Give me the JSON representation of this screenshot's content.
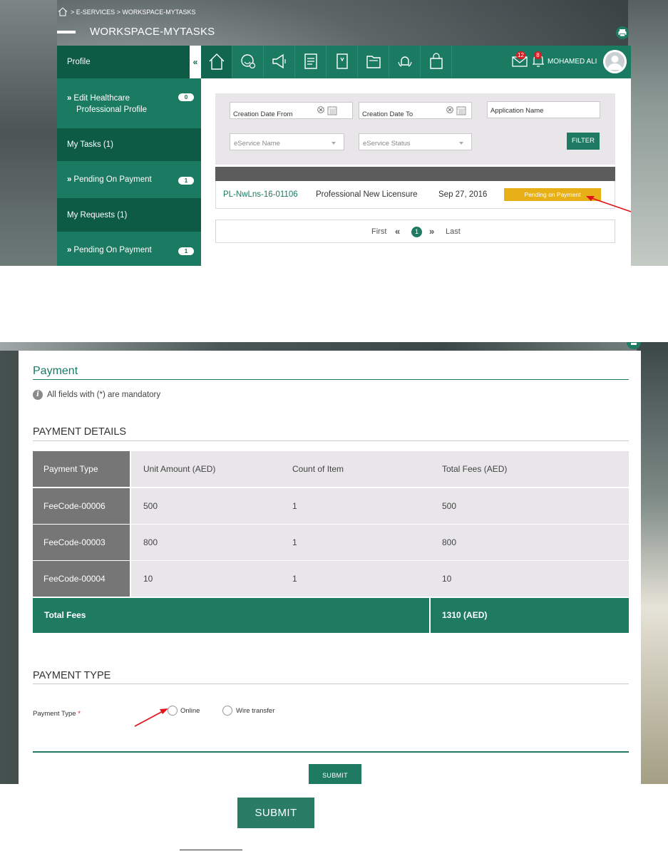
{
  "workspace": {
    "breadcrumb": "> E-SERVICES > WORKSPACE-MYTASKS",
    "title": "WORKSPACE-MYTASKS",
    "collapse_glyph": "«",
    "icons": [
      "home-icon",
      "support-settings-icon",
      "megaphone-icon",
      "checklist-icon",
      "book-icon",
      "folders-icon",
      "bell-hands-icon",
      "shopping-bag-icon"
    ],
    "messages_count": "12",
    "notifications_count": "8",
    "user_name": "MOHAMED ALI"
  },
  "sidebar": {
    "profile": "Profile",
    "edit_profile_line1": "Edit Healthcare",
    "edit_profile_line2": "Professional Profile",
    "edit_profile_count": "0",
    "my_tasks": "My Tasks (1)",
    "tasks_pending": "Pending On Payment",
    "tasks_pending_count": "1",
    "my_requests": "My Requests (1)",
    "requests_pending": "Pending On Payment",
    "requests_pending_count": "1",
    "chevron": "»"
  },
  "filters": {
    "creation_from": "Creation Date From",
    "creation_to": "Creation Date To",
    "application_name": "Application Name",
    "eservice_name": "eService Name",
    "eservice_status": "eService Status",
    "filter_button": "FILTER"
  },
  "results": {
    "rows": [
      {
        "id": "PL-NwLns-16-01106",
        "service": "Professional New Licensure",
        "date": "Sep 27, 2016",
        "status": "Pending on Payment"
      }
    ]
  },
  "pager": {
    "first": "First",
    "prev": "«",
    "current": "1",
    "next": "»",
    "last": "Last"
  },
  "payment": {
    "title": "Payment",
    "mandatory_note": "All fields with (*) are mandatory",
    "details_title": "PAYMENT DETAILS",
    "headers": [
      "Payment Type",
      "Unit Amount (AED)",
      "Count of Item",
      "Total Fees (AED)"
    ],
    "rows": [
      {
        "code": "FeeCode-00006",
        "unit": "500",
        "count": "1",
        "total": "500"
      },
      {
        "code": "FeeCode-00003",
        "unit": "800",
        "count": "1",
        "total": "800"
      },
      {
        "code": "FeeCode-00004",
        "unit": "10",
        "count": "1",
        "total": "10"
      }
    ],
    "total_label": "Total Fees",
    "total_value": "1310 (AED)",
    "type_title": "PAYMENT TYPE",
    "type_label": "Payment Type",
    "required_mark": "*",
    "option_online": "Online",
    "option_wire": "Wire transfer",
    "submit_small": "SUBMIT"
  },
  "submit_large": "SUBMIT",
  "colors": {
    "brand_green": "#1f7a62",
    "dark_green": "#10664f",
    "status_yellow": "#e8b017",
    "annotation_red": "#e3111b"
  }
}
